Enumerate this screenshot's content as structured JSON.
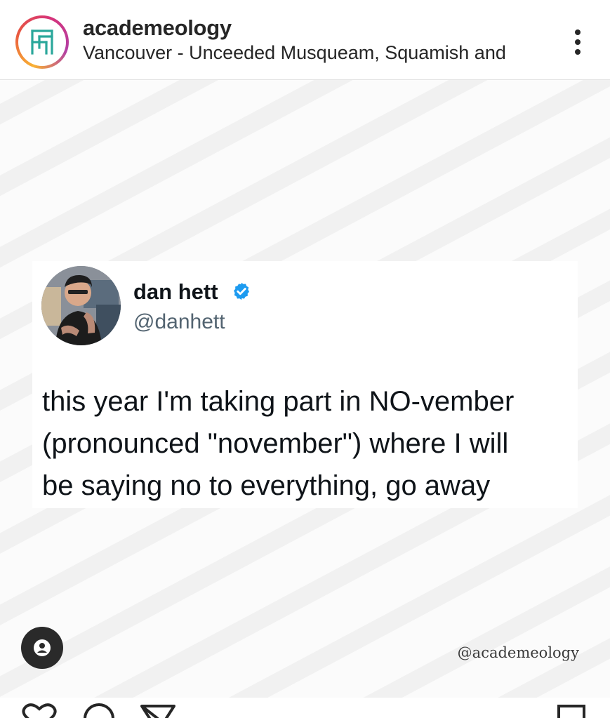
{
  "header": {
    "username": "academeology",
    "location": "Vancouver - Unceeded Musqueam, Squamish and",
    "more_icon": "more-vertical-icon"
  },
  "tweet": {
    "name": "dan hett",
    "handle": "@danhett",
    "verified_icon": "verified-badge-icon",
    "text_lines": [
      "this year I'm taking part in NO-vember",
      "(pronounced \"november\") where I will",
      "be saying no to everything, go away"
    ]
  },
  "watermark": "@academeology",
  "tag_icon": "user-tag-icon",
  "actions": {
    "like_icon": "heart-icon",
    "comment_icon": "comment-icon",
    "share_icon": "send-icon",
    "save_icon": "bookmark-icon"
  },
  "colors": {
    "text_primary": "#262626",
    "tweet_text": "#0f1419",
    "tweet_handle": "#536471",
    "verified_blue": "#1d9bf0",
    "ring_gradient": [
      "#f9b233",
      "#e8573f",
      "#d6337a",
      "#b23fa5"
    ],
    "logo_teal": "#2aa79b"
  }
}
